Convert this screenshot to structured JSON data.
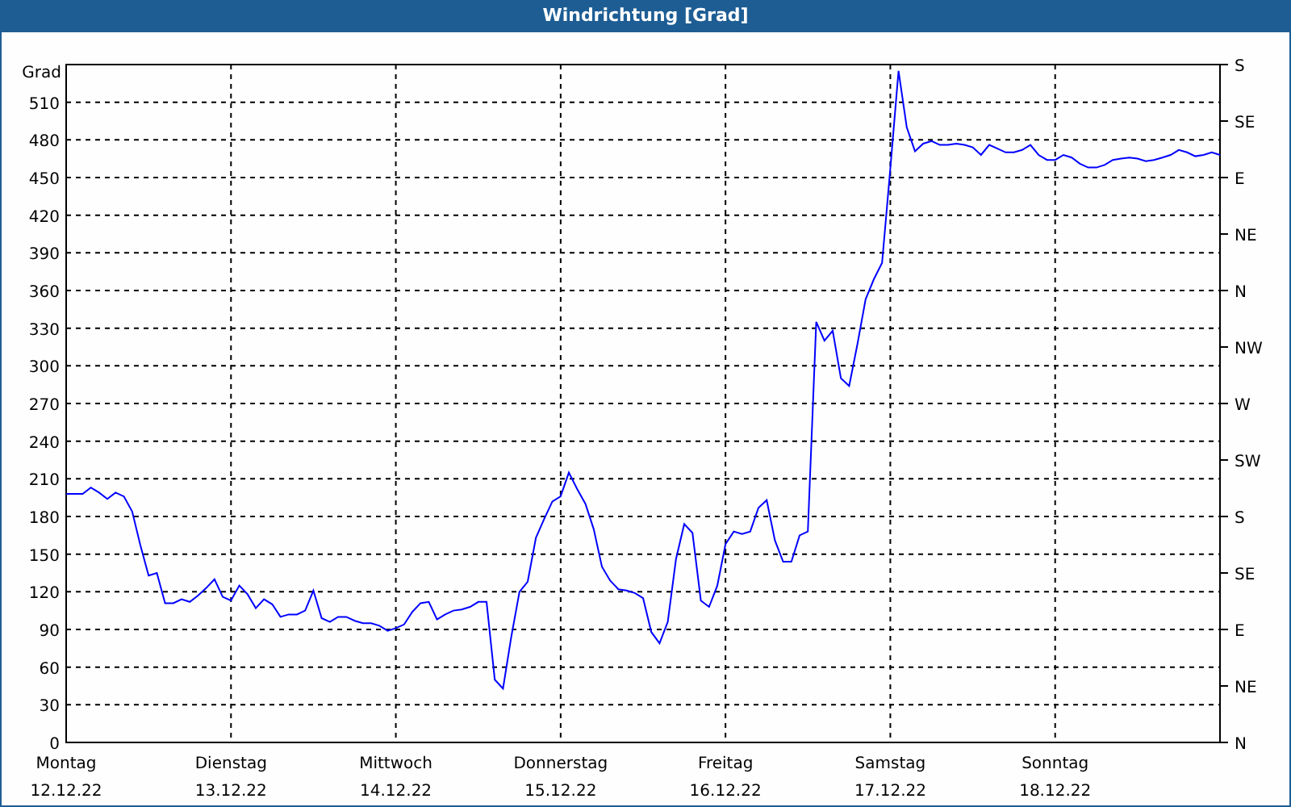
{
  "window": {
    "title": "Windrichtung [Grad]"
  },
  "chart": {
    "chart_data": {
      "type": "line",
      "grid": true,
      "ylabel": "Grad",
      "ylim": [
        0,
        540
      ],
      "yticks": [
        0,
        30,
        60,
        90,
        120,
        150,
        180,
        210,
        240,
        270,
        300,
        330,
        360,
        390,
        420,
        450,
        480,
        510
      ],
      "categories": [
        "Montag",
        null,
        null,
        null,
        null,
        null,
        null,
        null,
        null,
        null,
        null,
        null,
        null,
        null,
        null,
        null,
        null,
        null,
        null,
        null,
        "Dienstag",
        null,
        null,
        null,
        null,
        null,
        null,
        null,
        null,
        null,
        null,
        null,
        null,
        null,
        null,
        null,
        null,
        null,
        null,
        null,
        "Mittwoch",
        null,
        null,
        null,
        null,
        null,
        null,
        null,
        null,
        null,
        null,
        null,
        null,
        null,
        null,
        null,
        null,
        null,
        null,
        null,
        "Donnerstag",
        null,
        null,
        null,
        null,
        null,
        null,
        null,
        null,
        null,
        null,
        null,
        null,
        null,
        null,
        null,
        null,
        null,
        null,
        null,
        "Freitag",
        null,
        null,
        null,
        null,
        null,
        null,
        null,
        null,
        null,
        null,
        null,
        null,
        null,
        null,
        null,
        null,
        null,
        null,
        null,
        "Samstag",
        null,
        null,
        null,
        null,
        null,
        null,
        null,
        null,
        null,
        null,
        null,
        null,
        null,
        null,
        null,
        null,
        null,
        null,
        null,
        "Sonntag",
        null,
        null,
        null,
        null,
        null,
        null,
        null,
        null,
        null,
        null,
        null,
        null,
        null,
        null,
        null,
        null,
        null,
        null,
        null,
        null
      ],
      "series": [
        {
          "color": "#0000ff",
          "values": [
            198,
            198,
            198,
            203,
            199,
            194,
            199,
            196,
            184,
            157,
            133,
            135,
            111,
            111,
            114,
            112,
            117,
            123,
            130,
            116,
            113,
            125,
            118,
            107,
            114,
            110,
            100,
            102,
            102,
            105,
            121,
            99,
            96,
            100,
            100,
            97,
            95,
            95,
            93,
            89,
            91,
            94,
            104,
            111,
            112,
            98,
            102,
            105,
            106,
            108,
            112,
            112,
            50,
            43,
            84,
            120,
            128,
            163,
            178,
            192,
            196,
            215,
            202,
            190,
            170,
            140,
            129,
            122,
            121,
            119,
            115,
            88,
            79,
            96,
            146,
            174,
            167,
            113,
            108,
            125,
            158,
            168,
            166,
            168,
            187,
            193,
            161,
            144,
            144,
            165,
            168,
            335,
            320,
            328,
            290,
            284,
            317,
            353,
            369,
            382,
            457,
            535,
            490,
            471,
            477,
            479,
            476,
            476,
            477,
            476,
            474,
            468,
            476,
            473,
            470,
            470,
            472,
            476,
            468,
            464,
            464,
            468,
            466,
            461,
            458,
            458,
            460,
            464,
            465,
            466,
            465,
            463,
            464,
            466,
            468,
            472,
            470,
            467,
            468,
            470,
            468
          ]
        }
      ]
    },
    "x_dates": [
      "12.12.22",
      "13.12.22",
      "14.12.22",
      "15.12.22",
      "16.12.22",
      "17.12.22",
      "18.12.22"
    ],
    "right_axis_labels": [
      "S",
      "SE",
      "E",
      "NE",
      "N",
      "NW",
      "W",
      "SW",
      "S",
      "SE",
      "E",
      "NE",
      "N"
    ]
  }
}
